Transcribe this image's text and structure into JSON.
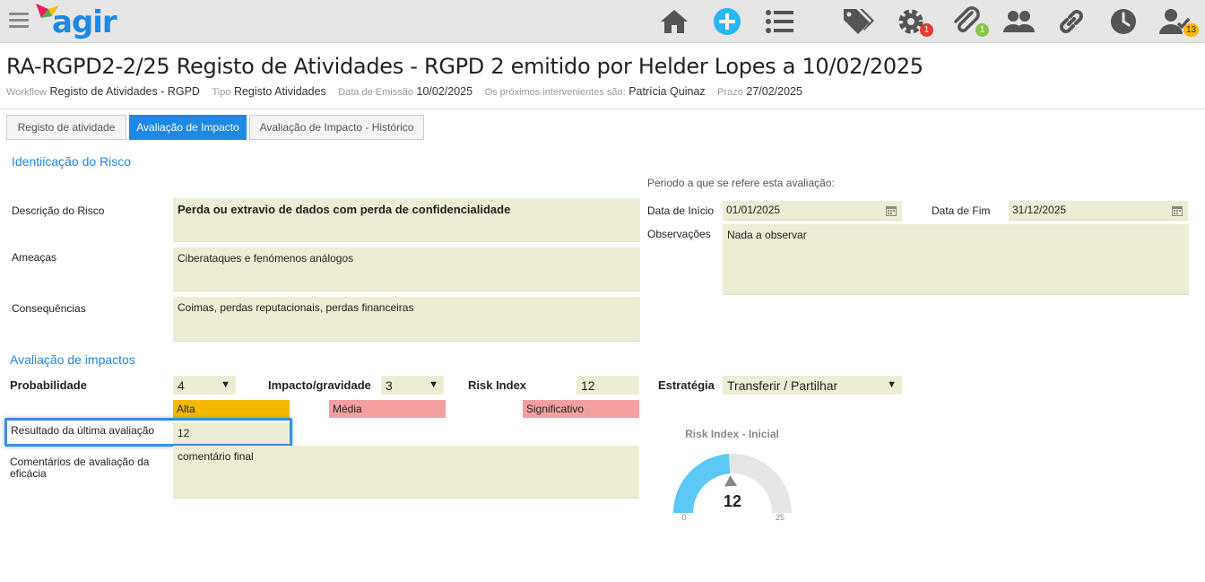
{
  "brand": {
    "name": "agir"
  },
  "toolbar": {
    "icons": [
      "home-icon",
      "add-icon",
      "list-icon",
      "tags-icon",
      "gear-icon",
      "paperclip-icon",
      "users-icon",
      "link-icon",
      "clock-icon",
      "user-check-icon"
    ],
    "badges": {
      "settings": "1",
      "attachments": "1",
      "tasks": "13"
    }
  },
  "header": {
    "title": "RA-RGPD2-2/25 Registo de Atividades - RGPD 2 emitido por Helder Lopes a 10/02/2025",
    "meta": [
      {
        "k": "Workflow",
        "v": "Registo de Atividades - RGPD"
      },
      {
        "k": "Tipo",
        "v": "Registo Atividades"
      },
      {
        "k": "Data de Emissão",
        "v": "10/02/2025"
      },
      {
        "k": "Os próximos intervenientes são:",
        "v": "Patrícia Quinaz"
      },
      {
        "k": "Prazo",
        "v": "27/02/2025"
      }
    ]
  },
  "tabs": [
    "Registo de atividade",
    "Avaliação de Impacto",
    "Avaliação de Impacto - Histórico"
  ],
  "risk": {
    "section_title": "Identiicação do Risco",
    "descricao_label": "Descrição do Risco",
    "descricao_value": "Perda ou extravio de dados com perda de confidencialidade",
    "ameacas_label": "Ameaças",
    "ameacas_value": "Ciberataques e fenómenos análogos",
    "consequencias_label": "Consequências",
    "consequencias_value": "Coimas, perdas reputacionais, perdas financeiras",
    "periodo_label": "Periodo a que se refere esta avaliação:",
    "inicio_label": "Data de Início",
    "inicio_value": "01/01/2025",
    "fim_label": "Data de Fim",
    "fim_value": "31/12/2025",
    "observacoes_label": "Observações",
    "observacoes_value": "Nada a observar"
  },
  "impact": {
    "section_title": "Avaliação de impactos",
    "probabilidade_label": "Probabilidade",
    "probabilidade_value": "4",
    "probabilidade_level": "Alta",
    "impacto_label": "Impacto/gravidade",
    "impacto_value": "3",
    "impacto_level": "Média",
    "risk_index_label": "Risk Index",
    "risk_index_value": "12",
    "risk_level": "Significativo",
    "estrategia_label": "Estratégia",
    "estrategia_value": "Transferir / Partilhar",
    "resultado_label": "Resultado da última avaliação",
    "resultado_value": "12",
    "comentarios_label": "Comentários de avaliação da eficácia",
    "comentarios_value": "comentário final"
  },
  "gauge": {
    "title": "Risk Index - Inicial",
    "value": 12,
    "value_text": "12",
    "min": 0,
    "max": 25,
    "min_text": "0",
    "max_text": "25"
  },
  "colors": {
    "accent": "#1e88e5",
    "field_bg": "#ededd6",
    "alta": "#f5b800",
    "media": "#f5a0a0",
    "significativo": "#f5a0a0",
    "gauge_fill": "#5bc8f5",
    "gauge_track": "#e6e6e6"
  }
}
